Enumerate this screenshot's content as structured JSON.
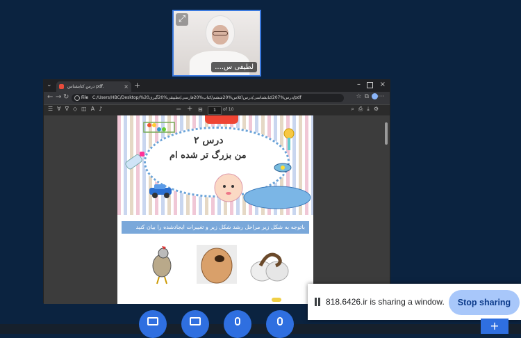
{
  "presenter": {
    "name": "لطیفی س...."
  },
  "browser": {
    "tab_title": "درس کتابشناس pdf.",
    "url_scheme": "File",
    "url_path": "C:/Users/HBC/Desktop/%20درس%207کتابشناسی/درس/کلاس%20ششم/کتاب%20فارسی/تطبیقی%20گیری/pdf",
    "page_current": "1",
    "page_total": "of 10"
  },
  "document": {
    "lesson_number": "درس ۲",
    "lesson_title": "من بزرگ تر شده ام",
    "question": "باتوجه به شکل زیر مراحل رشد شکل زیر و تغییرات ایجادشده را بیان کنید"
  },
  "share_notification": {
    "message": "818.6426.ir is sharing a window.",
    "stop_label": "Stop sharing"
  },
  "colors": {
    "background": "#0b2340",
    "accent": "#2f6fe0",
    "stop_button": "#a8c7fa",
    "question_bar": "#7aa8da"
  }
}
